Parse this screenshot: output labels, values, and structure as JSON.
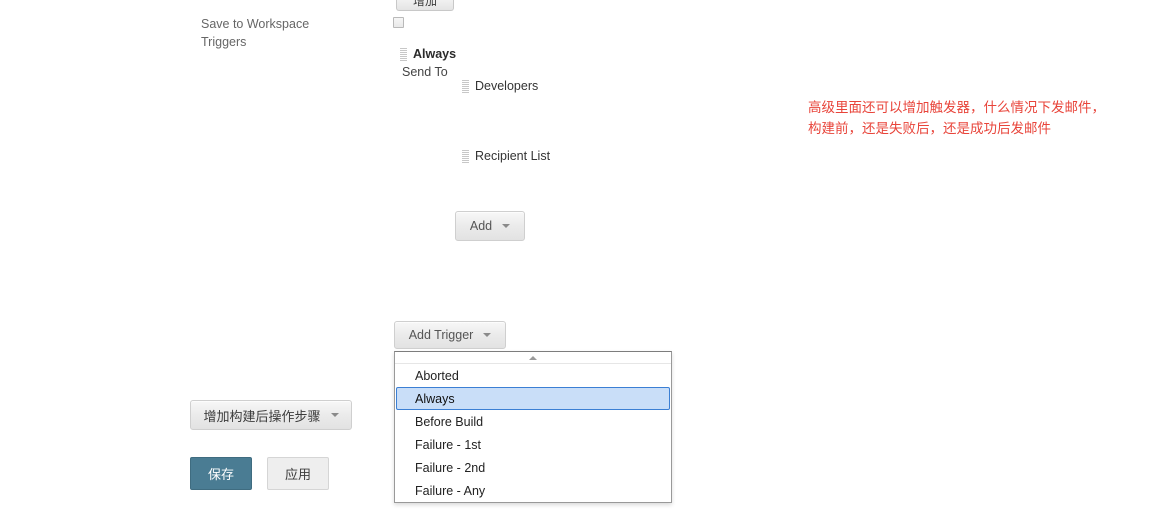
{
  "left_panel": {
    "labels": [
      {
        "text": "Save to Workspace"
      },
      {
        "text": "Triggers"
      }
    ],
    "post_build_button": {
      "label": "增加构建后操作步骤",
      "caret_icon": "chevron-down-icon"
    },
    "save_button": {
      "label": "保存"
    },
    "apply_button": {
      "label": "应用"
    }
  },
  "top_partial_button": {
    "label": "增加"
  },
  "checkbox": {
    "name": "save-to-workspace-checkbox",
    "checked": false
  },
  "trigger_block": {
    "trigger_name": "Always",
    "send_to_label": "Send To",
    "recipients": [
      {
        "label": "Developers",
        "handle_icon": "drag-handle-icon"
      },
      {
        "label": "Recipient List",
        "handle_icon": "drag-handle-icon"
      }
    ],
    "handle_icon": "drag-handle-icon",
    "add_button": {
      "label": "Add",
      "caret_icon": "chevron-down-icon"
    }
  },
  "add_trigger": {
    "button_label": "Add Trigger",
    "caret_icon": "chevron-down-icon",
    "menu": {
      "scroll_up_icon": "scroll-up-arrow-icon",
      "selected": "Always",
      "items": [
        {
          "label": "Aborted"
        },
        {
          "label": "Always"
        },
        {
          "label": "Before Build"
        },
        {
          "label": "Failure - 1st"
        },
        {
          "label": "Failure - 2nd"
        },
        {
          "label": "Failure - Any"
        }
      ]
    }
  },
  "annotation": {
    "line1": "高级里面还可以增加触发器，什么情况下发邮件，",
    "line2": "构建前，还是失败后，还是成功后发邮件"
  },
  "colors": {
    "accent_save": "#4a7c93",
    "menu_highlight_bg": "#c9deF8",
    "menu_highlight_border": "#3b7fd4",
    "annotation_red": "#e8443a"
  }
}
